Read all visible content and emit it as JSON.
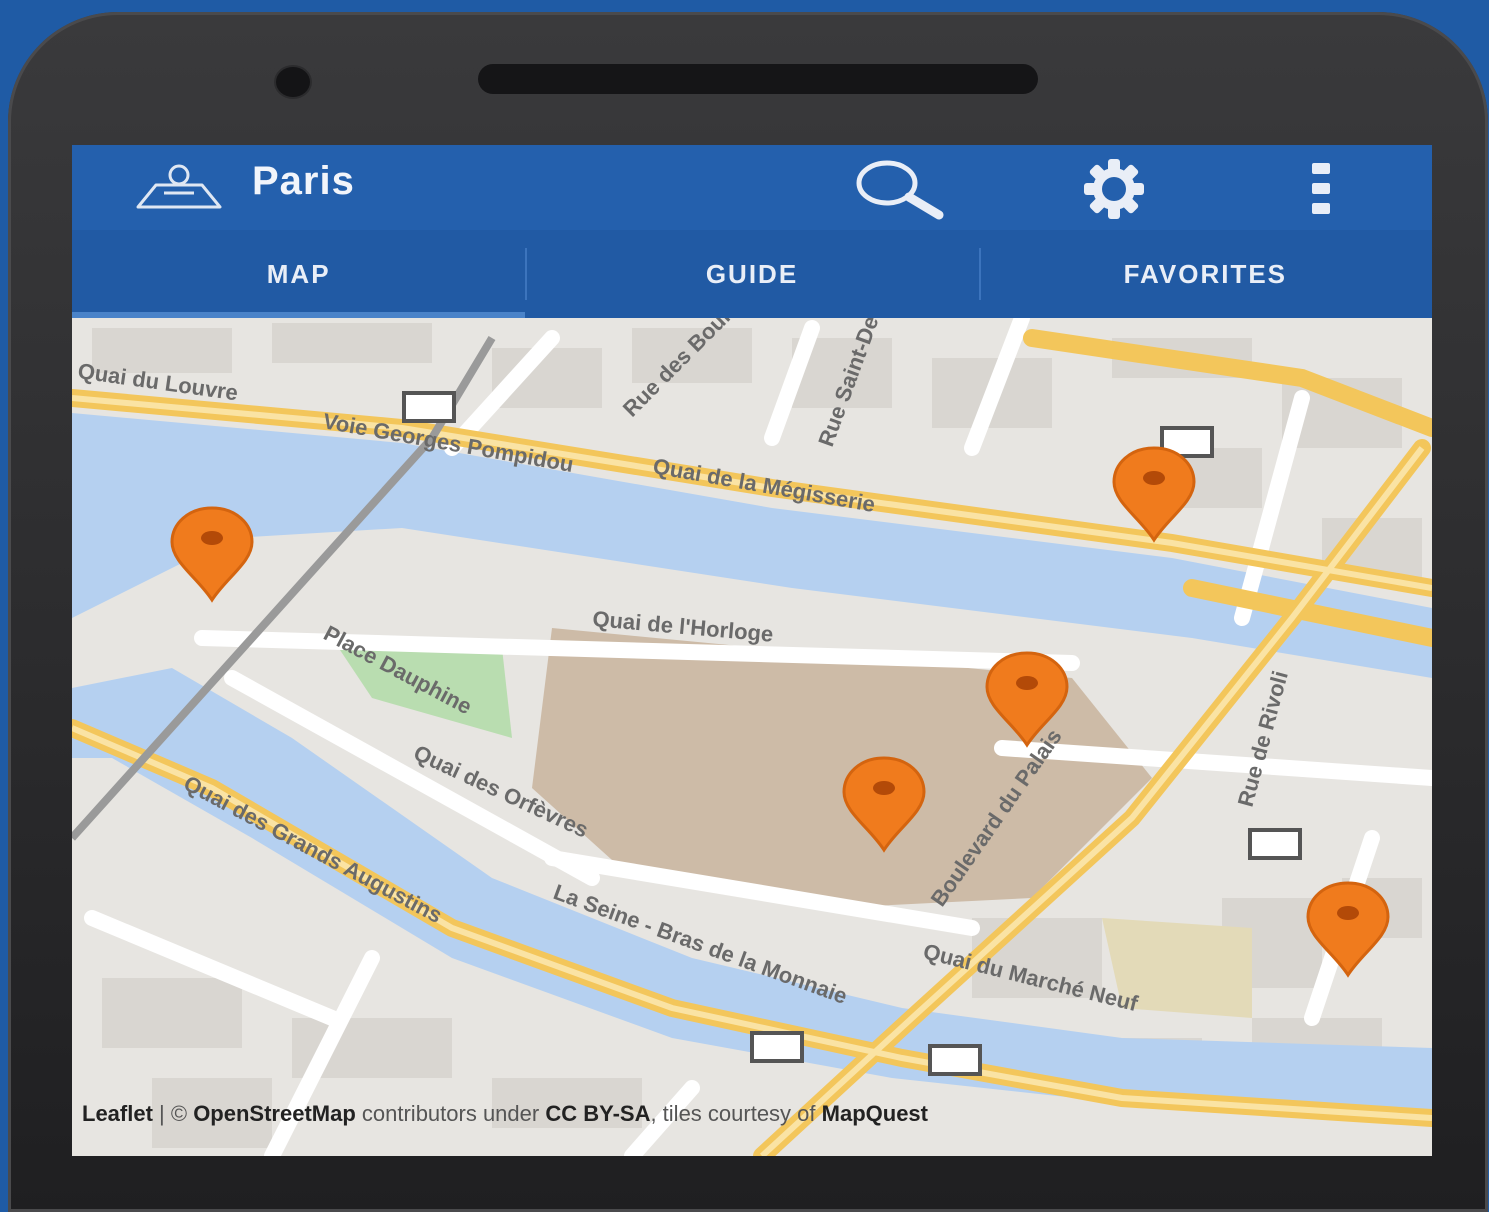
{
  "app": {
    "title": "Paris",
    "icons": {
      "logo": "traveler-icon",
      "search": "search-icon",
      "settings": "gear-icon",
      "more": "overflow-menu-icon"
    }
  },
  "tabs": [
    {
      "label": "MAP",
      "active": true
    },
    {
      "label": "GUIDE",
      "active": false
    },
    {
      "label": "FAVORITES",
      "active": false
    }
  ],
  "map": {
    "labels": [
      "Quai du Louvre",
      "Voie Georges Pompidou",
      "Quai de la Mégisserie",
      "Quai de l'Horloge",
      "Place Dauphine",
      "Quai des Orfèvres",
      "Quai des Grands Augustins",
      "La Seine - Bras de la Monnaie",
      "Boulevard du Palais",
      "Quai du Marché Neuf",
      "Rue de Rivoli",
      "Rue des Bourdonnais",
      "Rue Saint-Denis"
    ],
    "markers": 5,
    "marker_color": "#f07b1d",
    "water_color": "#b5d0f0",
    "road_color": "#f7d36a"
  },
  "attribution": {
    "leaflet": "Leaflet",
    "sep": " | © ",
    "osm": "OpenStreetMap",
    "contrib": " contributors under ",
    "license": "CC BY-SA",
    "tiles": ", tiles courtesy of ",
    "provider": "MapQuest"
  }
}
